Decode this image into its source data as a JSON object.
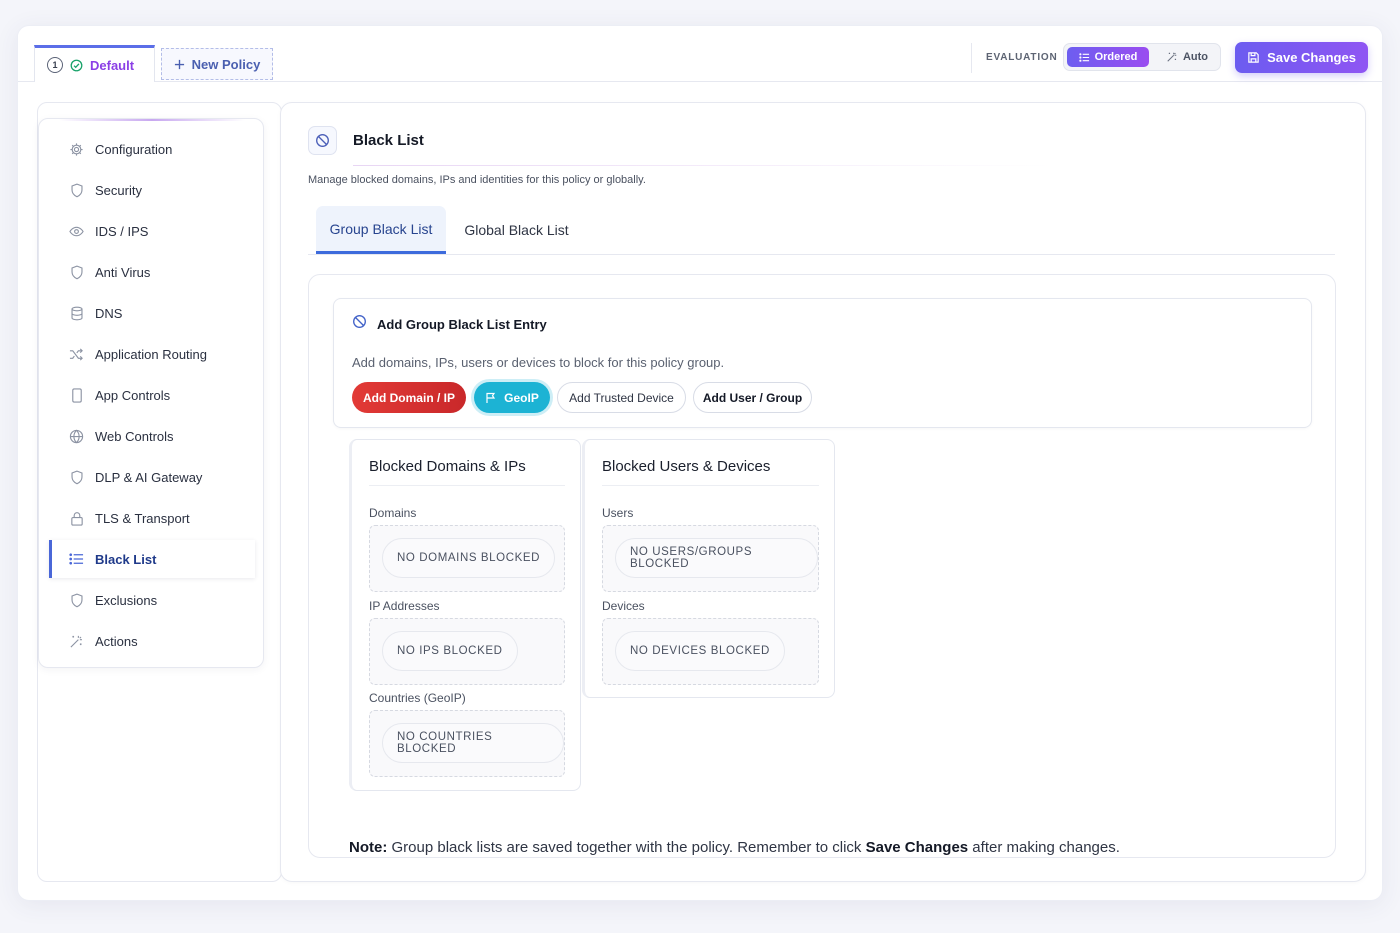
{
  "topbar": {
    "tabs": [
      {
        "number": "1",
        "label": "Default",
        "active": true
      },
      {
        "label": "New Policy"
      }
    ],
    "evaluation_label": "EVALUATION",
    "evaluation_modes": [
      {
        "label": "Ordered",
        "active": true
      },
      {
        "label": "Auto",
        "active": false
      }
    ],
    "save_label": "Save Changes"
  },
  "sidebar": {
    "items": [
      {
        "label": "Configuration",
        "icon": "gear-icon"
      },
      {
        "label": "Security",
        "icon": "shield-icon"
      },
      {
        "label": "IDS / IPS",
        "icon": "eye-icon"
      },
      {
        "label": "Anti Virus",
        "icon": "shield-icon"
      },
      {
        "label": "DNS",
        "icon": "database-icon"
      },
      {
        "label": "Application Routing",
        "icon": "shuffle-icon"
      },
      {
        "label": "App Controls",
        "icon": "mobile-icon"
      },
      {
        "label": "Web Controls",
        "icon": "globe-icon"
      },
      {
        "label": "DLP & AI Gateway",
        "icon": "shield-icon"
      },
      {
        "label": "TLS & Transport",
        "icon": "lock-icon"
      },
      {
        "label": "Black List",
        "icon": "list-icon",
        "active": true
      },
      {
        "label": "Exclusions",
        "icon": "shield-icon"
      },
      {
        "label": "Actions",
        "icon": "wand-icon"
      }
    ]
  },
  "main": {
    "title": "Black List",
    "subtitle": "Manage blocked domains, IPs and identities for this policy or globally.",
    "tabs": [
      {
        "label": "Group Black List",
        "active": true
      },
      {
        "label": "Global Black List",
        "active": false
      }
    ],
    "add_entry": {
      "title": "Add Group Black List Entry",
      "description": "Add domains, IPs, users or devices to block for this policy group.",
      "buttons": {
        "domain": "Add Domain / IP",
        "geoip": "GeoIP",
        "trusted": "Add Trusted Device",
        "user": "Add User / Group"
      }
    },
    "blocked_domains": {
      "title": "Blocked Domains & IPs",
      "domains_label": "Domains",
      "domains_empty": "NO DOMAINS BLOCKED",
      "ips_label": "IP Addresses",
      "ips_empty": "NO IPS BLOCKED",
      "countries_label": "Countries (GeoIP)",
      "countries_empty": "NO COUNTRIES BLOCKED"
    },
    "blocked_users": {
      "title": "Blocked Users & Devices",
      "users_label": "Users",
      "users_empty": "NO USERS/GROUPS BLOCKED",
      "devices_label": "Devices",
      "devices_empty": "NO DEVICES BLOCKED"
    },
    "note": {
      "prefix": "Note:",
      "text1": " Group black lists are saved together with the policy. Remember to click ",
      "bold": "Save Changes",
      "text2": " after making changes."
    }
  },
  "colors": {
    "accent_purple": "#8b3fe6",
    "primary_blue": "#3d6bdc",
    "danger_red": "#e23a36",
    "geoip_teal": "#1cb3d4"
  }
}
